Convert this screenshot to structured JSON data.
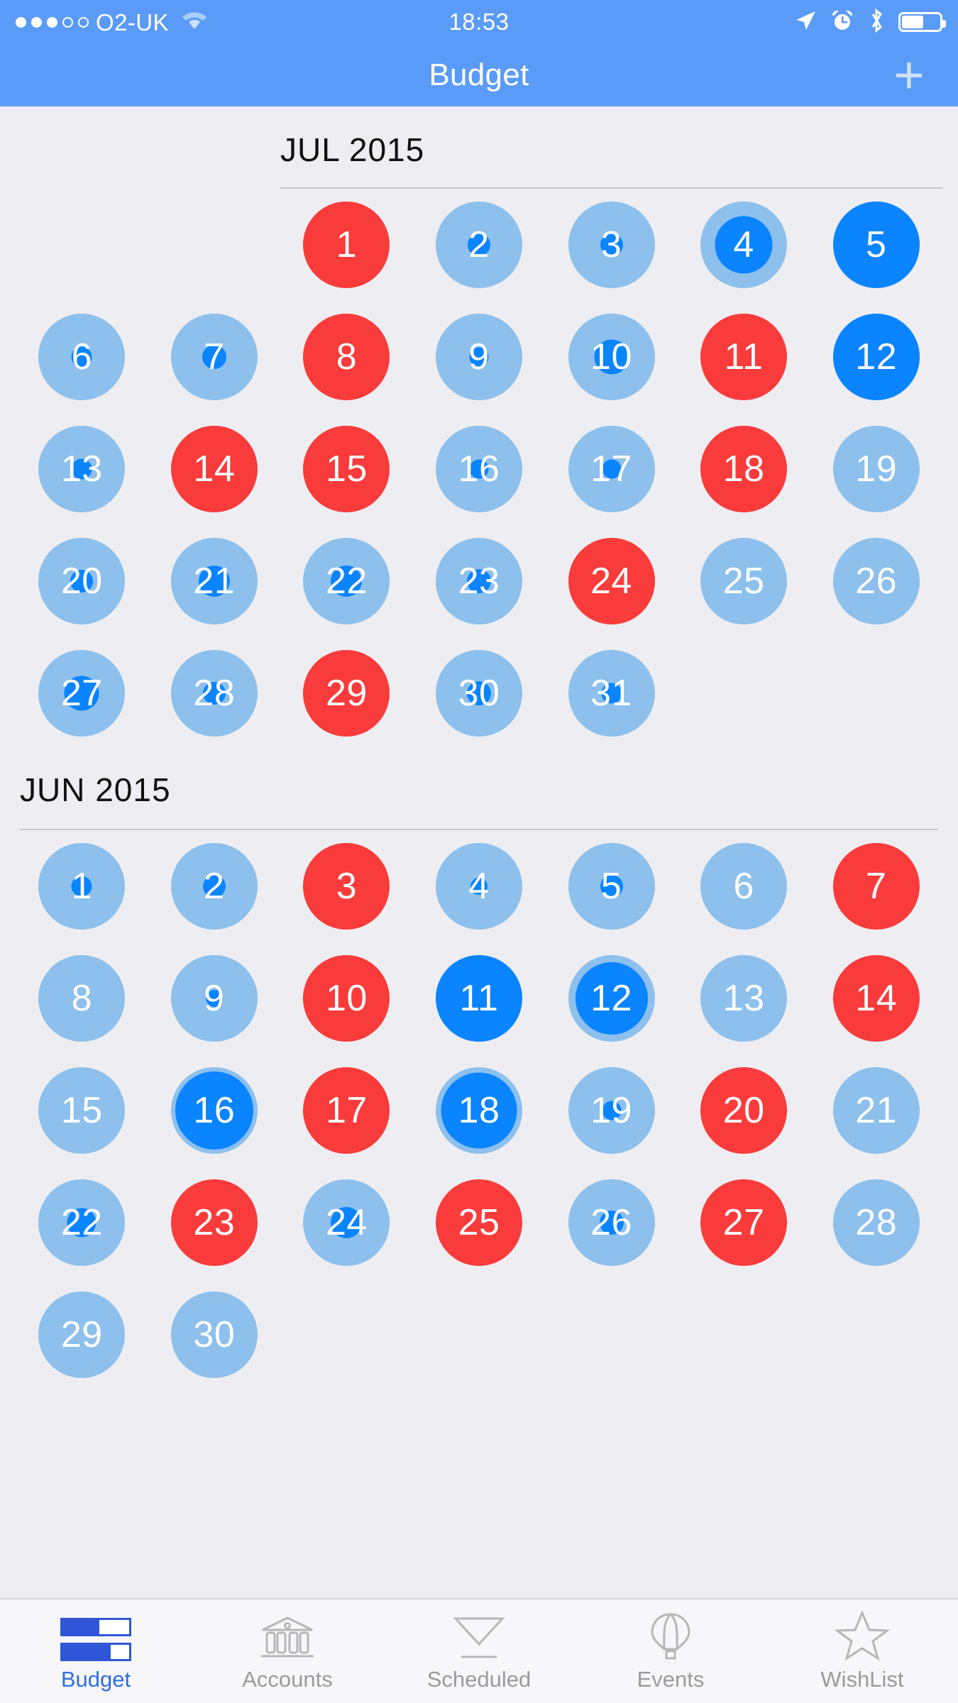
{
  "statusbar": {
    "carrier": "O2-UK",
    "time": "18:53",
    "signal_dots_filled": 3,
    "signal_dots_total": 5,
    "wifi_icon": "wifi-icon",
    "location_icon": "location-arrow-icon",
    "alarm_icon": "alarm-clock-icon",
    "bluetooth_icon": "bluetooth-icon",
    "battery_icon": "battery-icon",
    "battery_percent": 55
  },
  "navbar": {
    "title": "Budget",
    "add_label": "+",
    "background": "#5b9bf8"
  },
  "colors": {
    "nav_blue": "#5b9bf8",
    "light_blue": "#8dc0ec",
    "accent_blue": "#0a84ff",
    "red": "#f93b3b",
    "page_bg": "#eeeef2",
    "tab_active": "#2f6fe0",
    "tab_inactive": "#9a9aa0"
  },
  "months": [
    {
      "id": "jul",
      "title": "JUL 2015",
      "lead_blanks": 2,
      "days": [
        {
          "n": "1",
          "state": "red",
          "fill": 0
        },
        {
          "n": "2",
          "state": "light",
          "fill": 26
        },
        {
          "n": "3",
          "state": "light",
          "fill": 26
        },
        {
          "n": "4",
          "state": "light",
          "fill": 66
        },
        {
          "n": "5",
          "state": "full",
          "fill": 100
        },
        {
          "n": "6",
          "state": "light",
          "fill": 24
        },
        {
          "n": "7",
          "state": "light",
          "fill": 28
        },
        {
          "n": "8",
          "state": "red",
          "fill": 0
        },
        {
          "n": "9",
          "state": "light",
          "fill": 22
        },
        {
          "n": "10",
          "state": "light",
          "fill": 40
        },
        {
          "n": "11",
          "state": "red",
          "fill": 0
        },
        {
          "n": "12",
          "state": "full",
          "fill": 100
        },
        {
          "n": "13",
          "state": "light",
          "fill": 24
        },
        {
          "n": "14",
          "state": "red",
          "fill": 0
        },
        {
          "n": "15",
          "state": "red",
          "fill": 0
        },
        {
          "n": "16",
          "state": "light",
          "fill": 22
        },
        {
          "n": "17",
          "state": "light",
          "fill": 22
        },
        {
          "n": "18",
          "state": "red",
          "fill": 0
        },
        {
          "n": "19",
          "state": "light",
          "fill": 0
        },
        {
          "n": "20",
          "state": "light",
          "fill": 26
        },
        {
          "n": "21",
          "state": "light",
          "fill": 36
        },
        {
          "n": "22",
          "state": "light",
          "fill": 36
        },
        {
          "n": "23",
          "state": "light",
          "fill": 28
        },
        {
          "n": "24",
          "state": "red",
          "fill": 0
        },
        {
          "n": "25",
          "state": "light",
          "fill": 0
        },
        {
          "n": "26",
          "state": "light",
          "fill": 0
        },
        {
          "n": "27",
          "state": "light",
          "fill": 40
        },
        {
          "n": "28",
          "state": "light",
          "fill": 26
        },
        {
          "n": "29",
          "state": "red",
          "fill": 0
        },
        {
          "n": "30",
          "state": "light",
          "fill": 28
        },
        {
          "n": "31",
          "state": "light",
          "fill": 24
        }
      ]
    },
    {
      "id": "jun",
      "title": "JUN 2015",
      "lead_blanks": 0,
      "days": [
        {
          "n": "1",
          "state": "light",
          "fill": 24
        },
        {
          "n": "2",
          "state": "light",
          "fill": 26
        },
        {
          "n": "3",
          "state": "red",
          "fill": 0
        },
        {
          "n": "4",
          "state": "light",
          "fill": 20
        },
        {
          "n": "5",
          "state": "light",
          "fill": 26
        },
        {
          "n": "6",
          "state": "light",
          "fill": 0
        },
        {
          "n": "7",
          "state": "red",
          "fill": 0
        },
        {
          "n": "8",
          "state": "light",
          "fill": 0
        },
        {
          "n": "9",
          "state": "light",
          "fill": 20
        },
        {
          "n": "10",
          "state": "red",
          "fill": 0
        },
        {
          "n": "11",
          "state": "full",
          "fill": 100
        },
        {
          "n": "12",
          "state": "light",
          "fill": 84
        },
        {
          "n": "13",
          "state": "light",
          "fill": 0
        },
        {
          "n": "14",
          "state": "red",
          "fill": 0
        },
        {
          "n": "15",
          "state": "light",
          "fill": 0
        },
        {
          "n": "16",
          "state": "light",
          "fill": 90
        },
        {
          "n": "17",
          "state": "red",
          "fill": 0
        },
        {
          "n": "18",
          "state": "light",
          "fill": 88
        },
        {
          "n": "19",
          "state": "light",
          "fill": 22
        },
        {
          "n": "20",
          "state": "red",
          "fill": 0
        },
        {
          "n": "21",
          "state": "light",
          "fill": 0
        },
        {
          "n": "22",
          "state": "light",
          "fill": 34
        },
        {
          "n": "23",
          "state": "red",
          "fill": 0
        },
        {
          "n": "24",
          "state": "light",
          "fill": 36
        },
        {
          "n": "25",
          "state": "red",
          "fill": 0
        },
        {
          "n": "26",
          "state": "light",
          "fill": 28
        },
        {
          "n": "27",
          "state": "red",
          "fill": 0
        },
        {
          "n": "28",
          "state": "light",
          "fill": 0
        },
        {
          "n": "29",
          "state": "light",
          "fill": 0
        },
        {
          "n": "30",
          "state": "light",
          "fill": 0
        }
      ]
    }
  ],
  "tabbar": {
    "items": [
      {
        "label": "Budget",
        "icon": "budget-bars-icon",
        "active": true
      },
      {
        "label": "Accounts",
        "icon": "bank-icon",
        "active": false
      },
      {
        "label": "Scheduled",
        "icon": "hourglass-icon",
        "active": false
      },
      {
        "label": "Events",
        "icon": "hot-air-balloon-icon",
        "active": false
      },
      {
        "label": "WishList",
        "icon": "star-icon",
        "active": false
      }
    ]
  }
}
